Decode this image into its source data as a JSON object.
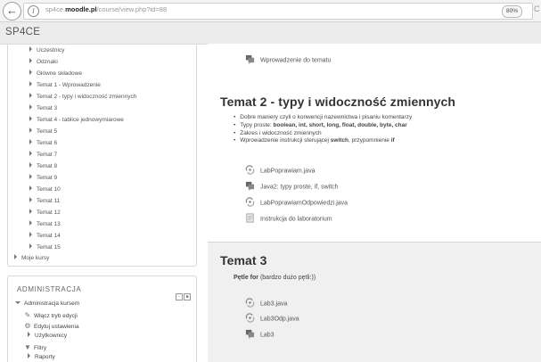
{
  "browser": {
    "url_prefix": "sp4ce.",
    "url_domain": "moodle.pl",
    "url_path": "/course/view.php?id=88",
    "zoom": "80%"
  },
  "site": {
    "name": "SP4CE"
  },
  "navigation": {
    "items": [
      "Uczestnicy",
      "Odznaki",
      "Główne składowe",
      "Temat 1 - Wprowadzenie",
      "Temat 2 - typy i widoczność zmiennych",
      "Temat 3",
      "Temat 4 - tablice jednowymiarowe",
      "Temat 5",
      "Temat 6",
      "Temat 7",
      "Temat 8",
      "Temat 9",
      "Temat 10",
      "Temat 11",
      "Temat 12",
      "Temat 13",
      "Temat 14",
      "Temat 15"
    ],
    "my_courses": "Moje kursy"
  },
  "admin": {
    "title": "ADMINISTRACJA",
    "course_admin": "Administracja kursem",
    "items": [
      "Włącz tryb edycji",
      "Edytuj ustawienia",
      "Użytkownicy",
      "Filtry",
      "Raporty"
    ]
  },
  "main": {
    "intro_activity": "Wprowadzenie do tematu",
    "section2": {
      "title": "Temat 2 - typy i widoczność zmiennych",
      "bullets": [
        {
          "pre": "Dobre maniery czyli o konwencji nazewnictwa i pisaniu komentarzy",
          "bold": "",
          "post": ""
        },
        {
          "pre": "Typy proste: ",
          "bold": "boolean, int, short, long, float, double, byte, char",
          "post": ""
        },
        {
          "pre": "Zakres i widoczność zmiennych",
          "bold": "",
          "post": ""
        },
        {
          "pre": "Wprowadzenie instrukcji sterującej ",
          "bold": "switch",
          "post": ", przypomnienie ",
          "bold2": "if"
        }
      ],
      "activities": [
        "LabPoprawiam.java",
        "Java2: typy proste, if, switch",
        "LabPoprawiamOdpowiedzi.java",
        "Instrukcja do laboratorium"
      ]
    },
    "section3": {
      "title": "Temat 3",
      "summary_bold": "Pętle for",
      "summary_rest": " (bardzo dużo pętli:))",
      "activities": [
        "Lab3.java",
        "Lab3Odp.java",
        "Lab3"
      ]
    }
  }
}
